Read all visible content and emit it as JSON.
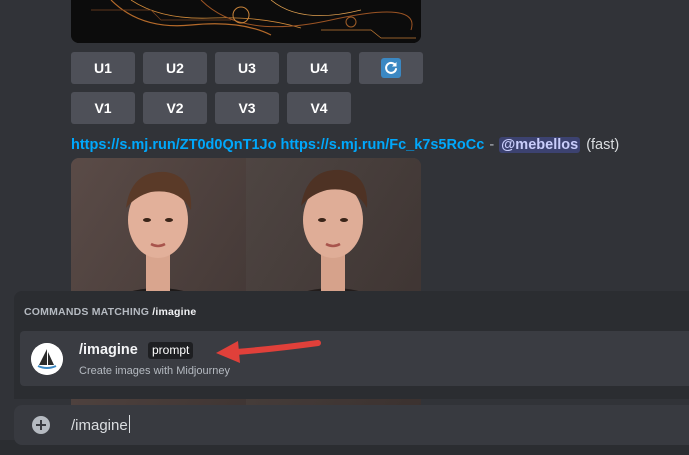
{
  "upscale_buttons": [
    "U1",
    "U2",
    "U3",
    "U4"
  ],
  "variation_buttons": [
    "V1",
    "V2",
    "V3",
    "V4"
  ],
  "reroll_icon": "refresh-icon",
  "message": {
    "link1": "https://s.mj.run/ZT0d0QnT1Jo",
    "link2": "https://s.mj.run/Fc_k7s5RoCc",
    "separator": "-",
    "mention": "@mebellos",
    "speed": "(fast)"
  },
  "command_popup": {
    "header_prefix": "COMMANDS MATCHING ",
    "header_query": "/imagine",
    "command": {
      "name": "/imagine",
      "param": "prompt",
      "description": "Create images with Midjourney",
      "icon": "midjourney-sailboat-icon"
    }
  },
  "input": {
    "value": "/imagine",
    "plus_icon": "plus-circle-icon"
  },
  "colors": {
    "background": "#313338",
    "link": "#00a8fc",
    "mention_bg": "#3c4270",
    "button": "#4e5058",
    "arrow": "#e0403a"
  }
}
